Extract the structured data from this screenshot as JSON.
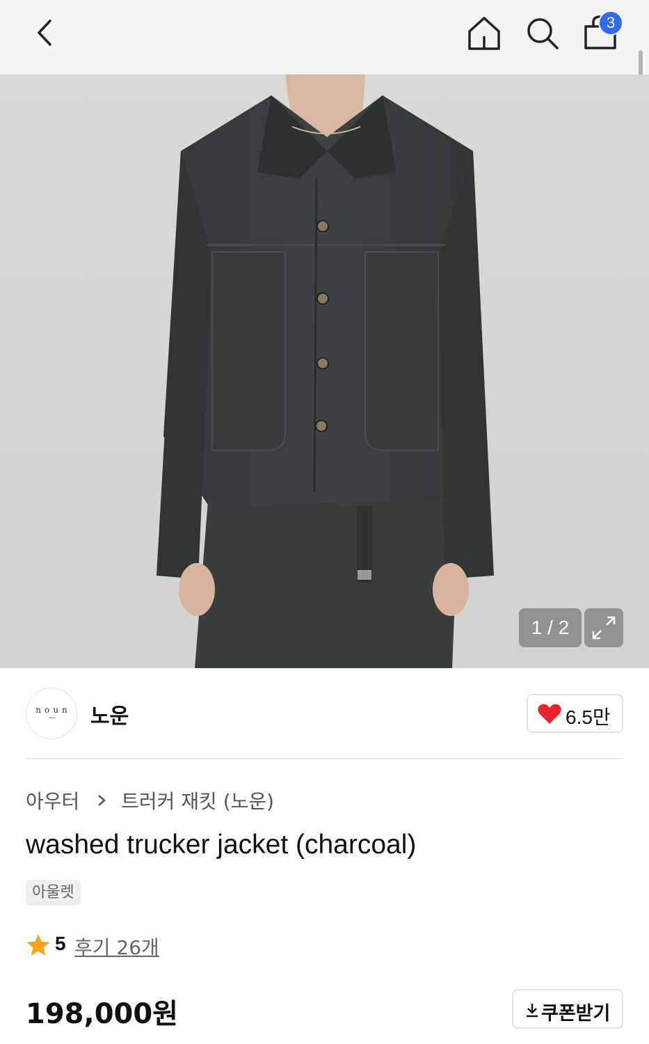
{
  "header": {
    "cart_count": "3",
    "icons": [
      "chevron-left-icon",
      "home-icon",
      "search-icon",
      "shopping-bag-icon"
    ]
  },
  "gallery": {
    "counter": "1 / 2",
    "expand_icon": "expand-icon"
  },
  "brand": {
    "logo_text": "noun",
    "name": "노운",
    "like_count": "6.5만",
    "like_icon": "heart-icon",
    "like_color": "#e8232f"
  },
  "breadcrumb": {
    "items": [
      "아우터",
      "트러커 재킷 (노운)"
    ]
  },
  "product": {
    "title": "washed trucker jacket (charcoal)",
    "tag": "아울렛",
    "rating": "5",
    "reviews": "후기 26개",
    "price": "198,000원"
  },
  "coupon": {
    "label": "쿠폰받기",
    "icon": "download-icon"
  },
  "colors": {
    "badge": "#2f6bf5",
    "star": "#f7a21b",
    "heart": "#e8232f"
  }
}
